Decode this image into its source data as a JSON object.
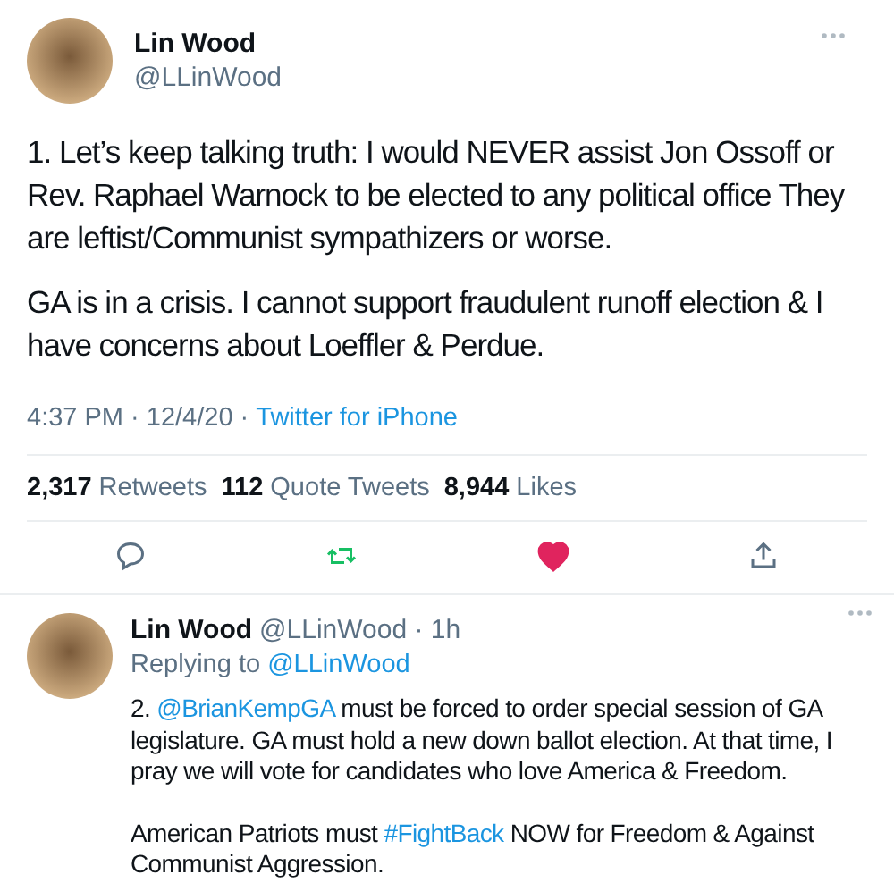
{
  "tweet": {
    "name": "Lin Wood",
    "handle": "@LLinWood",
    "paragraphs": [
      "1. Let’s keep talking truth: I would NEVER assist Jon Ossoff or Rev. Raphael Warnock to be elected to any political office They are leftist/Communist sympathizers or worse.",
      "GA is in a crisis. I cannot support fraudulent runoff election & I have concerns about Loeffler & Perdue."
    ],
    "time": "4:37 PM · 12/4/20 · ",
    "source": "Twitter for iPhone",
    "stats": [
      {
        "count": "2,317",
        "label": "Retweets"
      },
      {
        "count": "112",
        "label": "Quote Tweets"
      },
      {
        "count": "8,944",
        "label": "Likes"
      }
    ],
    "actions": [
      {
        "kind": "reply",
        "active": false
      },
      {
        "kind": "retweet",
        "active": true
      },
      {
        "kind": "like",
        "active": true
      },
      {
        "kind": "share",
        "active": false
      }
    ]
  },
  "reply": {
    "name": "Lin Wood",
    "handle": "@LLinWood · 1h",
    "replying_to": "Replying to ",
    "replying_handle": "@LLinWood",
    "paragraphs": [
      [
        {
          "kind": "text",
          "text": "2. "
        },
        {
          "kind": "link",
          "text": "@BrianKempGA"
        },
        {
          "kind": "text",
          "text": " must be forced to order special session of GA legislature. GA must hold a new down ballot election. At that time, I pray we will vote for candidates who love America & Freedom."
        }
      ],
      [
        {
          "kind": "text",
          "text": "American Patriots must "
        },
        {
          "kind": "link",
          "text": "#FightBack"
        },
        {
          "kind": "text",
          "text": " NOW for Freedom & Against Communist Aggression."
        }
      ]
    ]
  }
}
